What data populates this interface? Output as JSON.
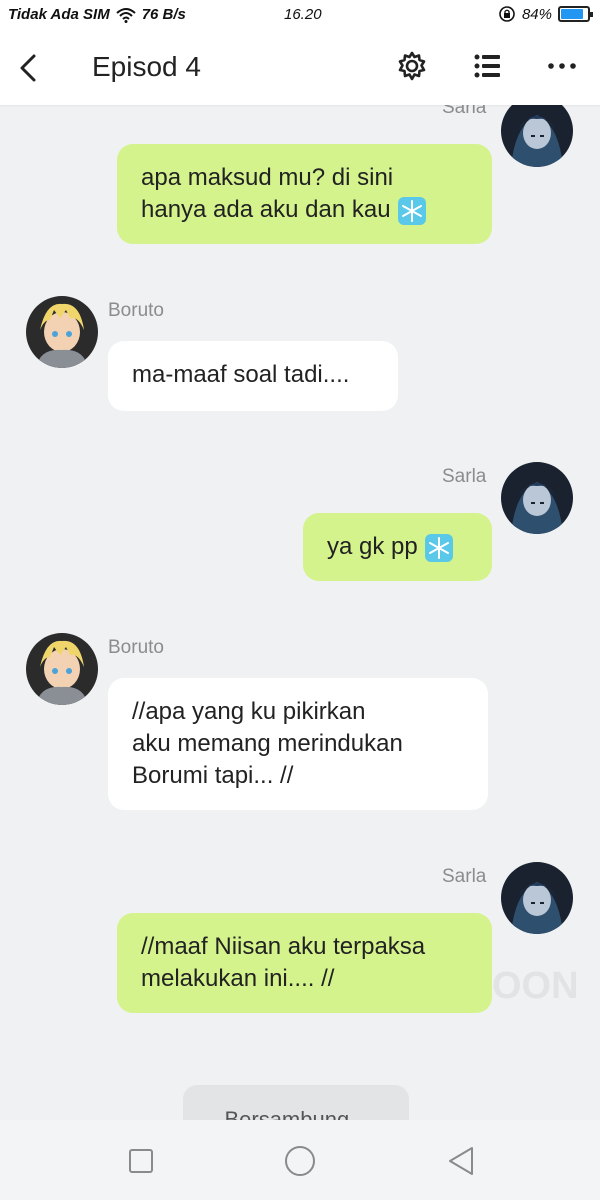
{
  "status_bar": {
    "carrier": "Tidak Ada SIM",
    "speed": "76 B/s",
    "time": "16.20",
    "battery_text": "84%",
    "battery_level": 0.84
  },
  "header": {
    "title": "Episod 4",
    "icons": [
      "back-arrow-icon",
      "gear-icon",
      "list-icon",
      "more-icon"
    ]
  },
  "messages": [
    {
      "sender": "Sarla",
      "side": "right",
      "text_lines": [
        "apa maksud mu? di sini",
        "hanya ada aku dan kau"
      ],
      "snowflake": true
    },
    {
      "sender": "Boruto",
      "side": "left",
      "text_lines": [
        "ma-maaf soal tadi...."
      ],
      "snowflake": false
    },
    {
      "sender": "Sarla",
      "side": "right",
      "text_lines": [
        "ya gk pp"
      ],
      "snowflake": true
    },
    {
      "sender": "Boruto",
      "side": "left",
      "text_lines": [
        "//apa yang ku pikirkan",
        "aku memang merindukan",
        "Borumi tapi... //"
      ],
      "snowflake": false
    },
    {
      "sender": "Sarla",
      "side": "right",
      "text_lines": [
        "//maaf Niisan aku terpaksa",
        "melakukan ini.... //"
      ],
      "snowflake": false
    }
  ],
  "watermark": "OON",
  "continued_label": "Bersambung...",
  "colors": {
    "sent_bubble": "#d5f38c",
    "received_bubble": "#ffffff",
    "background": "#f0f1f3",
    "name": "#8c8c8c"
  },
  "navbar": {
    "icons": [
      "recent-apps-icon",
      "home-icon",
      "back-icon"
    ]
  }
}
